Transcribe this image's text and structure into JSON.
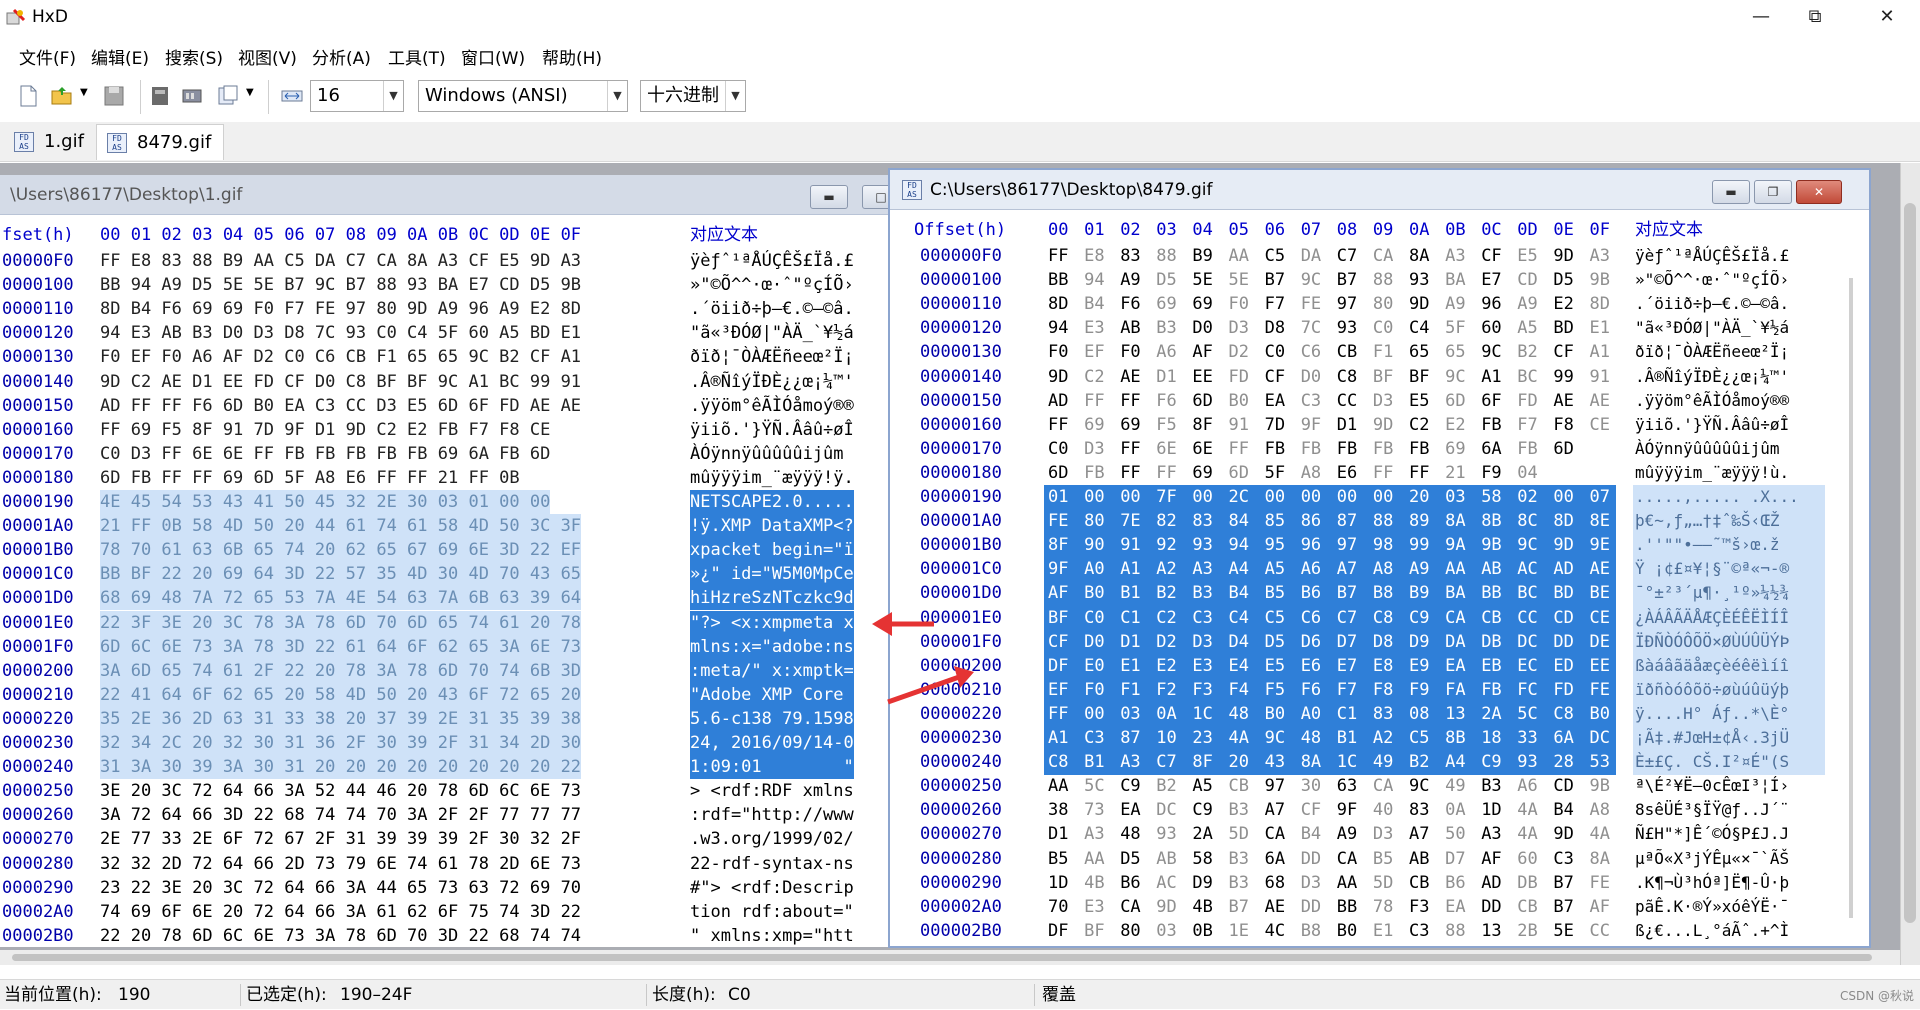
{
  "window": {
    "title": "HxD",
    "controls": [
      "minimize",
      "maximize",
      "close"
    ]
  },
  "menu": [
    "文件(F)",
    "编辑(E)",
    "搜索(S)",
    "视图(V)",
    "分析(A)",
    "工具(T)",
    "窗口(W)",
    "帮助(H)"
  ],
  "toolbar": {
    "bytes_per_row": "16",
    "charset": "Windows (ANSI)",
    "offset_base": "十六进制"
  },
  "tabs": [
    {
      "label": "1.gif",
      "active": false
    },
    {
      "label": "8479.gif",
      "active": true
    }
  ],
  "left_pane": {
    "title": "\\Users\\86177\\Desktop\\1.gif",
    "header_offset": "fset(h)",
    "header_text": "对应文本",
    "rows": [
      {
        "offset": "00000F0",
        "hex": "FF E8 83 88 B9 AA C5 DA C7 CA 8A A3 CF E5 9D A3",
        "text": "ÿèƒˆ¹ªÅÚÇÊŠ£Ïå.£"
      },
      {
        "offset": "0000100",
        "hex": "BB 94 A9 D5 5E 5E B7 9C B7 88 93 BA E7 CD D5 9B",
        "text": "»\"©Õ^^·œ·ˆ\"ºçÍÕ›"
      },
      {
        "offset": "0000110",
        "hex": "8D B4 F6 69 69 F0 F7 FE 97 80 9D A9 96 A9 E2 8D",
        "text": ".´öiið÷þ—€.©–©â."
      },
      {
        "offset": "0000120",
        "hex": "94 E3 AB B3 D0 D3 D8 7C 93 C0 C4 5F 60 A5 BD E1",
        "text": "\"ã«³ÐÓØ|\"ÀÄ_`¥½á"
      },
      {
        "offset": "0000130",
        "hex": "F0 EF F0 A6 AF D2 C0 C6 CB F1 65 65 9C B2 CF A1",
        "text": "ðïð¦¯ÒÀÆËñeeœ²Ï¡"
      },
      {
        "offset": "0000140",
        "hex": "9D C2 AE D1 EE FD CF D0 C8 BF BF 9C A1 BC 99 91",
        "text": ".Â®ÑîýÏÐÈ¿¿œ¡¼™'"
      },
      {
        "offset": "0000150",
        "hex": "AD FF FF F6 6D B0 EA C3 CC D3 E5 6D 6F FD AE AE",
        "text": ".ÿÿöm°êÃÌÓåmoý®®"
      },
      {
        "offset": "0000160",
        "hex": "FF 69 F5 8F 91 7D 9F D1 9D C2 E2 FB F7 F8 CE",
        "text": "ÿiiõ.'}ŸÑ.Ââû÷øÎ"
      },
      {
        "offset": "0000170",
        "hex": "C0 D3 FF 6E 6E FF FB FB FB FB FB 69 6A FB 6D",
        "text": "ÀÓÿnnÿûûûûûijûm"
      },
      {
        "offset": "0000180",
        "hex": "6D FB FF FF 69 6D 5F A8 E6 FF FF 21 FF 0B",
        "text": "mûÿÿÿim_¨æÿÿÿ!ÿ."
      },
      {
        "offset": "0000190",
        "hex": "4E 45 54 53 43 41 50 45 32 2E 30 03 01 00 00",
        "text": "NETSCAPE2.0....."
      },
      {
        "offset": "00001A0",
        "hex": "21 FF 0B 58 4D 50 20 44 61 74 61 58 4D 50 3C 3F",
        "text": "!ÿ.XMP DataXMP<?"
      },
      {
        "offset": "00001B0",
        "hex": "78 70 61 63 6B 65 74 20 62 65 67 69 6E 3D 22 EF",
        "text": "xpacket begin=\"ï"
      },
      {
        "offset": "00001C0",
        "hex": "BB BF 22 20 69 64 3D 22 57 35 4D 30 4D 70 43 65",
        "text": "»¿\" id=\"W5M0MpCe"
      },
      {
        "offset": "00001D0",
        "hex": "68 69 48 7A 72 65 53 7A 4E 54 63 7A 6B 63 39 64",
        "text": "hiHzreSzNTczkc9d"
      },
      {
        "offset": "00001E0",
        "hex": "22 3F 3E 20 3C 78 3A 78 6D 70 6D 65 74 61 20 78",
        "text": "\"?> <x:xmpmeta x"
      },
      {
        "offset": "00001F0",
        "hex": "6D 6C 6E 73 3A 78 3D 22 61 64 6F 62 65 3A 6E 73",
        "text": "mlns:x=\"adobe:ns"
      },
      {
        "offset": "0000200",
        "hex": "3A 6D 65 74 61 2F 22 20 78 3A 78 6D 70 74 6B 3D",
        "text": ":meta/\" x:xmptk="
      },
      {
        "offset": "0000210",
        "hex": "22 41 64 6F 62 65 20 58 4D 50 20 43 6F 72 65 20",
        "text": "\"Adobe XMP Core "
      },
      {
        "offset": "0000220",
        "hex": "35 2E 36 2D 63 31 33 38 20 37 39 2E 31 35 39 38",
        "text": "5.6-c138 79.1598"
      },
      {
        "offset": "0000230",
        "hex": "32 34 2C 20 32 30 31 36 2F 30 39 2F 31 34 2D 30",
        "text": "24, 2016/09/14-0"
      },
      {
        "offset": "0000240",
        "hex": "31 3A 30 39 3A 30 31 20 20 20 20 20 20 20 20 22",
        "text": "1:09:01        \""
      },
      {
        "offset": "0000250",
        "hex": "3E 20 3C 72 64 66 3A 52 44 46 20 78 6D 6C 6E 73",
        "text": "> <rdf:RDF xmlns"
      },
      {
        "offset": "0000260",
        "hex": "3A 72 64 66 3D 22 68 74 74 70 3A 2F 2F 77 77 77",
        "text": ":rdf=\"http://www"
      },
      {
        "offset": "0000270",
        "hex": "2E 77 33 2E 6F 72 67 2F 31 39 39 39 2F 30 32 2F",
        "text": ".w3.org/1999/02/"
      },
      {
        "offset": "0000280",
        "hex": "32 32 2D 72 64 66 2D 73 79 6E 74 61 78 2D 6E 73",
        "text": "22-rdf-syntax-ns"
      },
      {
        "offset": "0000290",
        "hex": "23 22 3E 20 3C 72 64 66 3A 44 65 73 63 72 69 70",
        "text": "#\"> <rdf:Descrip"
      },
      {
        "offset": "00002A0",
        "hex": "74 69 6F 6E 20 72 64 66 3A 61 62 6F 75 74 3D 22",
        "text": "tion rdf:about=\""
      },
      {
        "offset": "00002B0",
        "hex": "22 20 78 6D 6C 6E 73 3A 78 6D 70 3D 22 68 74 74",
        "text": "\" xmlns:xmp=\"htt"
      }
    ]
  },
  "right_pane": {
    "title": "C:\\Users\\86177\\Desktop\\8479.gif",
    "header_offset": "Offset(h)",
    "header_text": "对应文本",
    "col_headers": [
      "00",
      "01",
      "02",
      "03",
      "04",
      "05",
      "06",
      "07",
      "08",
      "09",
      "0A",
      "0B",
      "0C",
      "0D",
      "0E",
      "0F"
    ],
    "rows": [
      {
        "offset": "000000F0",
        "hex": "FF E8 83 88 B9 AA C5 DA C7 CA 8A A3 CF E5 9D A3",
        "text": "ÿèƒˆ¹ªÅÚÇÊŠ£Ïå.£"
      },
      {
        "offset": "00000100",
        "hex": "BB 94 A9 D5 5E 5E B7 9C B7 88 93 BA E7 CD D5 9B",
        "text": "»\"©Õ^^·œ·ˆ\"ºçÍÕ›"
      },
      {
        "offset": "00000110",
        "hex": "8D B4 F6 69 69 F0 F7 FE 97 80 9D A9 96 A9 E2 8D",
        "text": ".´öiið÷þ—€.©–©â."
      },
      {
        "offset": "00000120",
        "hex": "94 E3 AB B3 D0 D3 D8 7C 93 C0 C4 5F 60 A5 BD E1",
        "text": "\"ã«³ÐÓØ|\"ÀÄ_`¥½á"
      },
      {
        "offset": "00000130",
        "hex": "F0 EF F0 A6 AF D2 C0 C6 CB F1 65 65 9C B2 CF A1",
        "text": "ðïð¦¯ÒÀÆËñeeœ²Ï¡"
      },
      {
        "offset": "00000140",
        "hex": "9D C2 AE D1 EE FD CF D0 C8 BF BF 9C A1 BC 99 91",
        "text": ".Â®ÑîýÏÐÈ¿¿œ¡¼™'"
      },
      {
        "offset": "00000150",
        "hex": "AD FF FF F6 6D B0 EA C3 CC D3 E5 6D 6F FD AE AE",
        "text": ".ÿÿöm°êÃÌÓåmoý®®"
      },
      {
        "offset": "00000160",
        "hex": "FF 69 69 F5 8F 91 7D 9F D1 9D C2 E2 FB F7 F8 CE",
        "text": "ÿiiõ.'}ŸÑ.Ââû÷øÎ"
      },
      {
        "offset": "00000170",
        "hex": "C0 D3 FF 6E 6E FF FB FB FB FB FB 69 6A FB 6D",
        "text": "ÀÓÿnnÿûûûûûijûm"
      },
      {
        "offset": "00000180",
        "hex": "6D FB FF FF 69 6D 5F A8 E6 FF FF 21 F9 04",
        "text": "mûÿÿÿim_¨æÿÿÿ!ù."
      },
      {
        "offset": "00000190",
        "hex": "01 00 00 7F 00 2C 00 00 00 00 20 03 58 02 00 07",
        "text": ".....,..... .X..."
      },
      {
        "offset": "000001A0",
        "hex": "FE 80 7E 82 83 84 85 86 87 88 89 8A 8B 8C 8D 8E",
        "text": "þ€~‚ƒ„…†‡ˆ‰Š‹ŒŽ"
      },
      {
        "offset": "000001B0",
        "hex": "8F 90 91 92 93 94 95 96 97 98 99 9A 9B 9C 9D 9E",
        "text": ".''\"\"•–—˜™š›œ.ž"
      },
      {
        "offset": "000001C0",
        "hex": "9F A0 A1 A2 A3 A4 A5 A6 A7 A8 A9 AA AB AC AD AE",
        "text": "Ÿ ¡¢£¤¥¦§¨©ª«¬-®"
      },
      {
        "offset": "000001D0",
        "hex": "AF B0 B1 B2 B3 B4 B5 B6 B7 B8 B9 BA BB BC BD BE",
        "text": "¯°±²³´µ¶·¸¹º»¼½¾"
      },
      {
        "offset": "000001E0",
        "hex": "BF C0 C1 C2 C3 C4 C5 C6 C7 C8 C9 CA CB CC CD CE",
        "text": "¿ÀÁÂÃÄÅÆÇÈÉÊËÌÍÎ"
      },
      {
        "offset": "000001F0",
        "hex": "CF D0 D1 D2 D3 D4 D5 D6 D7 D8 D9 DA DB DC DD DE",
        "text": "ÏÐÑÒÓÔÕÖ×ØÙÚÛÜÝÞ"
      },
      {
        "offset": "00000200",
        "hex": "DF E0 E1 E2 E3 E4 E5 E6 E7 E8 E9 EA EB EC ED EE",
        "text": "ßàáâãäåæçèéêëìíî"
      },
      {
        "offset": "00000210",
        "hex": "EF F0 F1 F2 F3 F4 F5 F6 F7 F8 F9 FA FB FC FD FE",
        "text": "ïðñòóôõö÷øùúûüýþ"
      },
      {
        "offset": "00000220",
        "hex": "FF 00 03 0A 1C 48 B0 A0 C1 83 08 13 2A 5C C8 B0",
        "text": "ÿ....H° Áƒ..*\\È°"
      },
      {
        "offset": "00000230",
        "hex": "A1 C3 87 10 23 4A 9C 48 B1 A2 C5 8B 18 33 6A DC",
        "text": "¡Ã‡.#JœH±¢Å‹.3jÜ"
      },
      {
        "offset": "00000240",
        "hex": "C8 B1 A3 C7 8F 20 43 8A 1C 49 B2 A4 C9 93 28 53",
        "text": "È±£Ç. CŠ.I²¤É\"(S"
      },
      {
        "offset": "00000250",
        "hex": "AA 5C C9 B2 A5 CB 97 30 63 CA 9C 49 B3 A6 CD 9B",
        "text": "ª\\É²¥Ë—0cÊœI³¦Í›"
      },
      {
        "offset": "00000260",
        "hex": "38 73 EA DC C9 B3 A7 CF 9F 40 83 0A 1D 4A B4 A8",
        "text": "8sêÜÉ³§ÏŸ@ƒ..J´¨"
      },
      {
        "offset": "00000270",
        "hex": "D1 A3 48 93 2A 5D CA B4 A9 D3 A7 50 A3 4A 9D 4A",
        "text": "Ñ£H\"*]Ê´©Ó§P£J.J"
      },
      {
        "offset": "00000280",
        "hex": "B5 AA D5 AB 58 B3 6A DD CA B5 AB D7 AF 60 C3 8A",
        "text": "µªÕ«X³jÝÊµ«×¯`ÃŠ"
      },
      {
        "offset": "00000290",
        "hex": "1D 4B B6 AC D9 B3 68 D3 AA 5D CB B6 AD DB B7 FE",
        "text": ".K¶¬Ù³hÓª]Ë¶-Û·þ"
      },
      {
        "offset": "000002A0",
        "hex": "70 E3 CA 9D 4B B7 AE DD BB 78 F3 EA DD CB B7 AF",
        "text": "pãÊ.K·®Ý»xóêÝË·¯"
      },
      {
        "offset": "000002B0",
        "hex": "DF BF 80 03 0B 1E 4C B8 B0 E1 C3 88 13 2B 5E CC",
        "text": "ß¿€...L¸°áÃˆ.+^Ì"
      }
    ]
  },
  "status": {
    "position_label": "当前位置(h):",
    "position_value": "190",
    "selection_label": "已选定(h):",
    "selection_value": "190–24F",
    "length_label": "长度(h):",
    "length_value": "C0",
    "mode": "覆盖",
    "watermark": "CSDN @秋说"
  },
  "colors": {
    "selection_active": "#2f7fd8",
    "selection_inactive": "#cfe2f8",
    "offset_text": "#0000aa",
    "annotation_arrow": "#e53333"
  }
}
